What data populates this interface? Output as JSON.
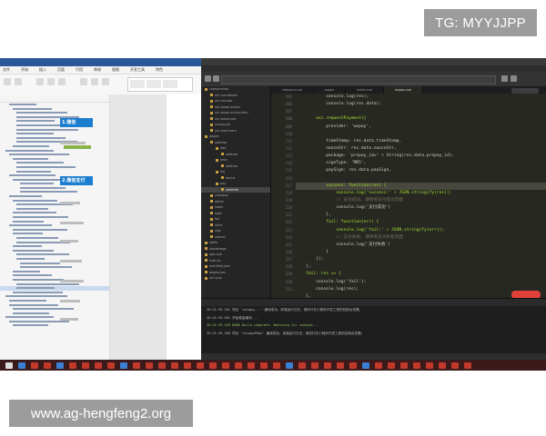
{
  "watermarks": {
    "top": "TG: MYYJJPP",
    "bottom": "www.ag-hengfeng2.org"
  },
  "doc": {
    "menu": [
      "文件",
      "开始",
      "插入",
      "页面",
      "引用",
      "审阅",
      "视图",
      "开发工具",
      "特色"
    ],
    "heading1": "1.微信",
    "heading2": "2.微信支付",
    "text_path": "path('wxpa"
  },
  "ide": {
    "tabs": [
      "category.vue",
      "pages",
      "index.vue",
      "mypay.vue"
    ],
    "tree": [
      "components",
      "uni-countdown",
      "uni-nav-bar",
      "uni-swipe-action",
      "uni-swipe-action-item",
      "uni-status-bar",
      "uniapp-bu",
      "uni-load-more",
      "pages",
      "address",
      "add",
      "address",
      "sells",
      "address",
      "list",
      "bonus",
      "pay",
      "userinfo",
      "category",
      "detail",
      "index",
      "login",
      "list",
      "mine",
      "sign",
      "setcart",
      "static",
      "unpackage",
      "app.vue",
      "main.js",
      "manifest.json",
      "pages.json",
      "uni.scss"
    ],
    "line_numbers": [
      "205",
      "206",
      "207",
      "208",
      "209",
      "210",
      "211",
      "212",
      "213",
      "214",
      "215",
      "216",
      "217",
      "218",
      "219",
      "220",
      "221",
      "222",
      "223",
      "224",
      "225",
      "226",
      "227",
      "228",
      "229",
      "230",
      "231"
    ],
    "code": [
      "            console.log(res);",
      "            console.log(res.data);",
      "",
      "        uni.requestPayment({",
      "            provider: 'wxpay',",
      "",
      "            timeStamp: res.data.timeStamp,",
      "            nonceStr: res.data.nonceStr,",
      "            package: 'prepay_id=' + String(res.data.prepay_id),",
      "            signType: 'MD5',",
      "            paySign: res.data.paySign,",
      "",
      "            success: function(res) {",
      "                console.log('success:' + JSON.stringify(res));",
      "                // 支付成功, 跳转到支付成功页面",
      "                console.log('支付成功')",
      "            },",
      "            fail: function(err) {",
      "                console.log('fail:' + JSON.stringify(err));",
      "                // 支付失败, 跳转到支付失败页面",
      "                console.log('支付失败')",
      "            }",
      "        });",
      "    },",
      "    fail: res => {",
      "        console.log('fail');",
      "        console.log(res);",
      "    },"
    ],
    "console": [
      "20:21:35.201 项目 'uniapp...' 编译成功。前端运行日志，请另行在小程序开发工具的控制台查看。",
      "20:21:35.561 开始差量编译...",
      "20:21:39.320 DONE  Build complete. Watching for changes...",
      "20:21:39.358 项目 'uniappPeke' 编译成功。前端运行日志，请另行在小程序开发工具的控制台查看。"
    ]
  }
}
